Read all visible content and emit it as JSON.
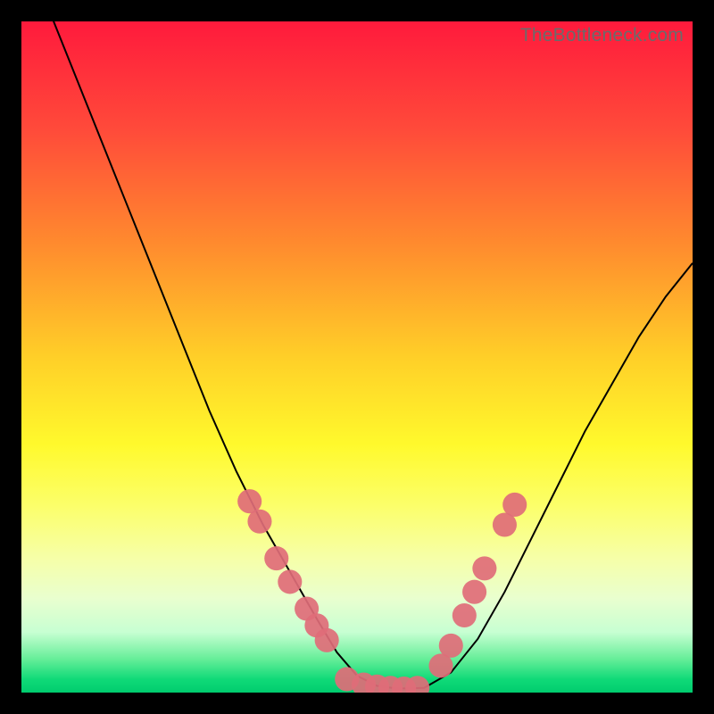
{
  "watermark": "TheBottleneck.com",
  "palette": {
    "frame_background": "#000000",
    "gradient_top": "#ff1a3c",
    "gradient_bottom": "#00cc6e",
    "curve_color": "#000000",
    "marker_color": "#df6d78"
  },
  "chart_data": {
    "type": "line",
    "title": "",
    "xlabel": "",
    "ylabel": "",
    "xlim": [
      0,
      100
    ],
    "ylim": [
      0,
      100
    ],
    "series": [
      {
        "name": "bottleneck-curve",
        "x": [
          0,
          4,
          8,
          12,
          16,
          20,
          24,
          28,
          32,
          36,
          40,
          44,
          47,
          50,
          53,
          56,
          60,
          64,
          68,
          72,
          76,
          80,
          84,
          88,
          92,
          96,
          100
        ],
        "y": [
          110,
          102,
          92,
          82,
          72,
          62,
          52,
          42,
          33,
          25,
          18,
          11,
          6,
          2.5,
          1,
          0.6,
          0.7,
          3,
          8,
          15,
          23,
          31,
          39,
          46,
          53,
          59,
          64
        ]
      }
    ],
    "markers": [
      {
        "name": "left-upper-a",
        "x": 34.0,
        "y": 28.5
      },
      {
        "name": "left-upper-b",
        "x": 35.5,
        "y": 25.5
      },
      {
        "name": "left-mid-a",
        "x": 38.0,
        "y": 20.0
      },
      {
        "name": "left-mid-b",
        "x": 40.0,
        "y": 16.5
      },
      {
        "name": "left-low-a",
        "x": 42.5,
        "y": 12.5
      },
      {
        "name": "left-low-b",
        "x": 44.0,
        "y": 10.0
      },
      {
        "name": "left-low-c",
        "x": 45.5,
        "y": 7.8
      },
      {
        "name": "floor-a",
        "x": 48.5,
        "y": 2.0
      },
      {
        "name": "floor-b",
        "x": 51.0,
        "y": 1.2
      },
      {
        "name": "floor-c",
        "x": 53.0,
        "y": 0.9
      },
      {
        "name": "floor-d",
        "x": 55.0,
        "y": 0.7
      },
      {
        "name": "floor-e",
        "x": 57.0,
        "y": 0.6
      },
      {
        "name": "floor-f",
        "x": 59.0,
        "y": 0.7
      },
      {
        "name": "right-low-a",
        "x": 62.5,
        "y": 4.0
      },
      {
        "name": "right-low-b",
        "x": 64.0,
        "y": 7.0
      },
      {
        "name": "right-mid-a",
        "x": 66.0,
        "y": 11.5
      },
      {
        "name": "right-mid-b",
        "x": 67.5,
        "y": 15.0
      },
      {
        "name": "right-mid-c",
        "x": 69.0,
        "y": 18.5
      },
      {
        "name": "right-upper-a",
        "x": 72.0,
        "y": 25.0
      },
      {
        "name": "right-upper-b",
        "x": 73.5,
        "y": 28.0
      }
    ],
    "marker_radius_data_units": 1.8
  }
}
